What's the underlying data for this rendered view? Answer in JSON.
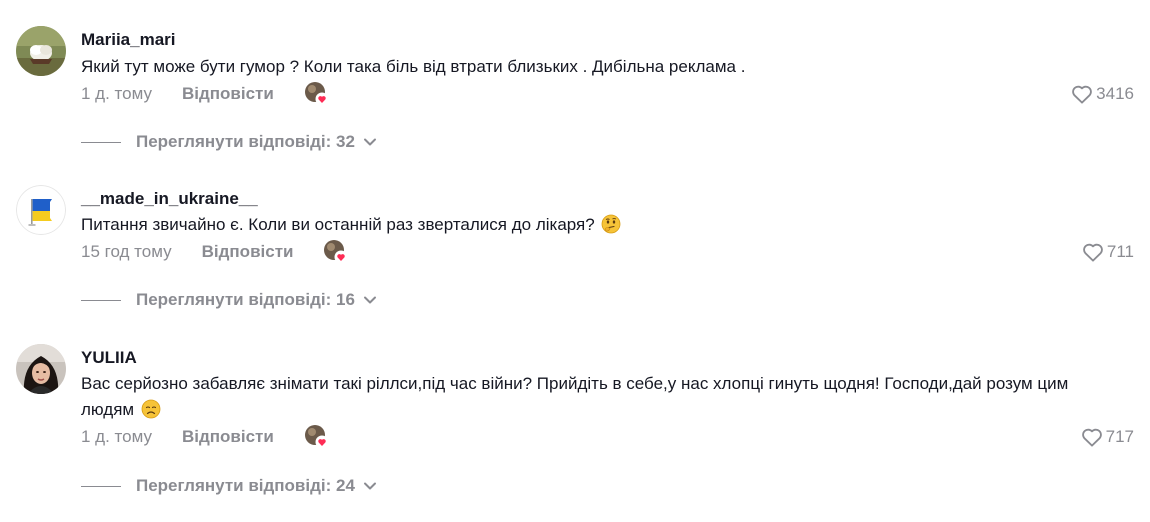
{
  "comments": [
    {
      "username": "Mariia_mari",
      "text": "Який тут може бути гумор ? Коли така біль від втрати близьких . Дибільна реклама .",
      "time": "1 д. тому",
      "reply_label": "Відповісти",
      "likes": "3416",
      "view_replies": "Переглянути відповіді: 32"
    },
    {
      "username": "__made_in_ukraine__",
      "text": "Питання звичайно є. Коли ви останній раз зверталися до лікаря?",
      "time": "15 год тому",
      "reply_label": "Відповісти",
      "likes": "711",
      "view_replies": "Переглянути відповіді: 16"
    },
    {
      "username": "YULIIA",
      "text": "Вас серйозно забавляє знімати такі ріллси,під час війни? Прийдіть в себе,у нас хлопці гинуть щодня! Господи,дай розум цим людям",
      "time": "1 д. тому",
      "reply_label": "Відповісти",
      "likes": "717",
      "view_replies": "Переглянути відповіді: 24"
    }
  ],
  "icons": {
    "like": "heart-outline-icon",
    "expand": "chevron-down-icon",
    "creator_liked": "creator-liked-heart-icon"
  },
  "colors": {
    "text": "#161823",
    "muted": "#8a8b91",
    "creator_heart": "#fe2c55"
  }
}
